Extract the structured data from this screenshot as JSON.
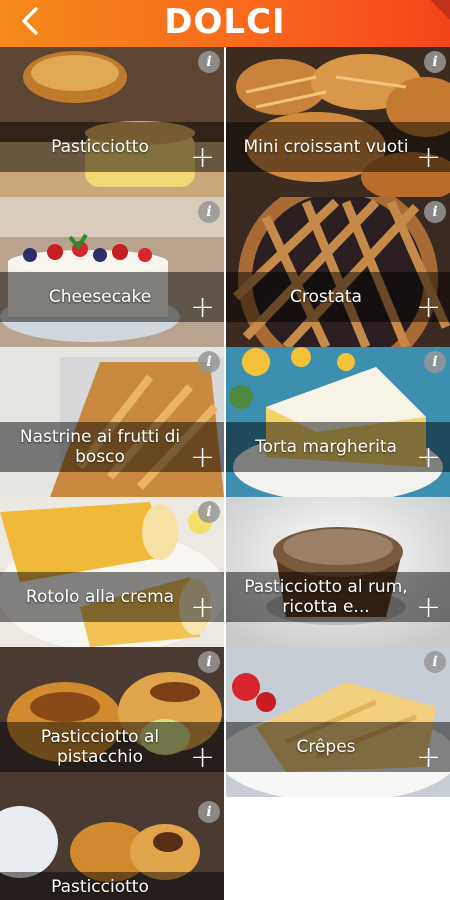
{
  "header": {
    "title": "DOLCI",
    "back_icon": "back-arrow-icon"
  },
  "tiles": [
    {
      "name": "Pasticciotto"
    },
    {
      "name": "Mini croissant vuoti"
    },
    {
      "name": "Cheesecake"
    },
    {
      "name": "Crostata"
    },
    {
      "name": "Nastrine ai frutti di bosco"
    },
    {
      "name": "Torta margherita"
    },
    {
      "name": "Rotolo alla crema"
    },
    {
      "name": "Pasticciotto al rum, ricotta e..."
    },
    {
      "name": "Pasticciotto al pistacchio"
    },
    {
      "name": "Crêpes"
    },
    {
      "name": "Pasticciotto"
    }
  ],
  "tile_info_icon": "info-icon",
  "tile_add_icon": "plus-icon",
  "colors": {
    "header_start": "#f58a1a",
    "header_end": "#f4441c",
    "text": "#ffffff"
  }
}
